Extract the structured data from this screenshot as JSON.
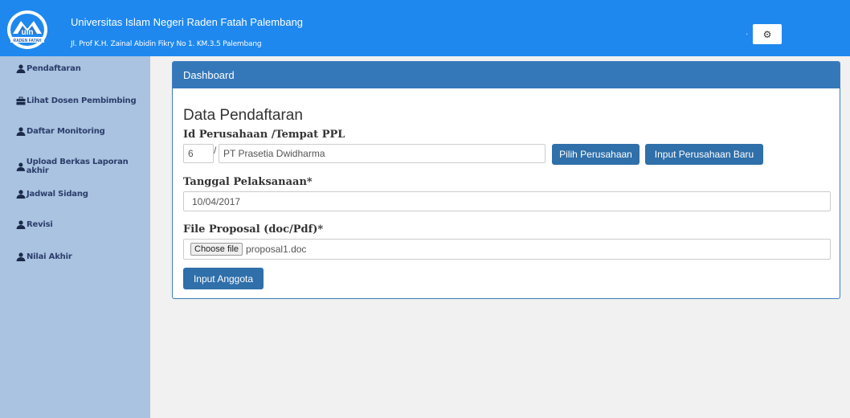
{
  "header": {
    "university": "Universitas Islam Negeri Raden Fatah Palembang",
    "address": "Jl. Prof K.H. Zainal Abidin Fikry No 1. KM.3.5 Palembang",
    "dot": "·",
    "logo_text": "uin",
    "logo_subtext": "RADEN FATAH"
  },
  "sidebar": {
    "items": [
      {
        "label": "Pendaftaran",
        "icon": "user-icon"
      },
      {
        "label": "Lihat Dosen Pembimbing",
        "icon": "briefcase-icon"
      },
      {
        "label": "Daftar Monitoring",
        "icon": "user-icon"
      },
      {
        "label": "Upload Berkas Laporan akhir",
        "icon": "user-icon"
      },
      {
        "label": "Jadwal Sidang",
        "icon": "user-icon"
      },
      {
        "label": "Revisi",
        "icon": "user-icon"
      },
      {
        "label": "Nilai Akhir",
        "icon": "user-icon"
      }
    ]
  },
  "panel": {
    "heading": "Dashboard",
    "title": "Data Pendaftaran",
    "company_label": "Id Perusahaan /Tempat PPL",
    "company_id": "6",
    "company_name": "PT Prasetia Dwidharma",
    "pick_company_label": "Pilih Perusahaan",
    "new_company_label": "Input Perusahaan Baru",
    "date_label": "Tanggal Pelaksanaan*",
    "date_value": "10/04/2017",
    "file_label": "File Proposal (doc/Pdf)*",
    "choose_file_label": "Choose file",
    "file_name": "proposal1.doc",
    "add_member_label": "Input Anggota"
  },
  "colors": {
    "topbar": "#1e88ef",
    "sidebar": "#a9c3e0",
    "panel_header": "#3478b9",
    "button": "#2f6faa"
  }
}
